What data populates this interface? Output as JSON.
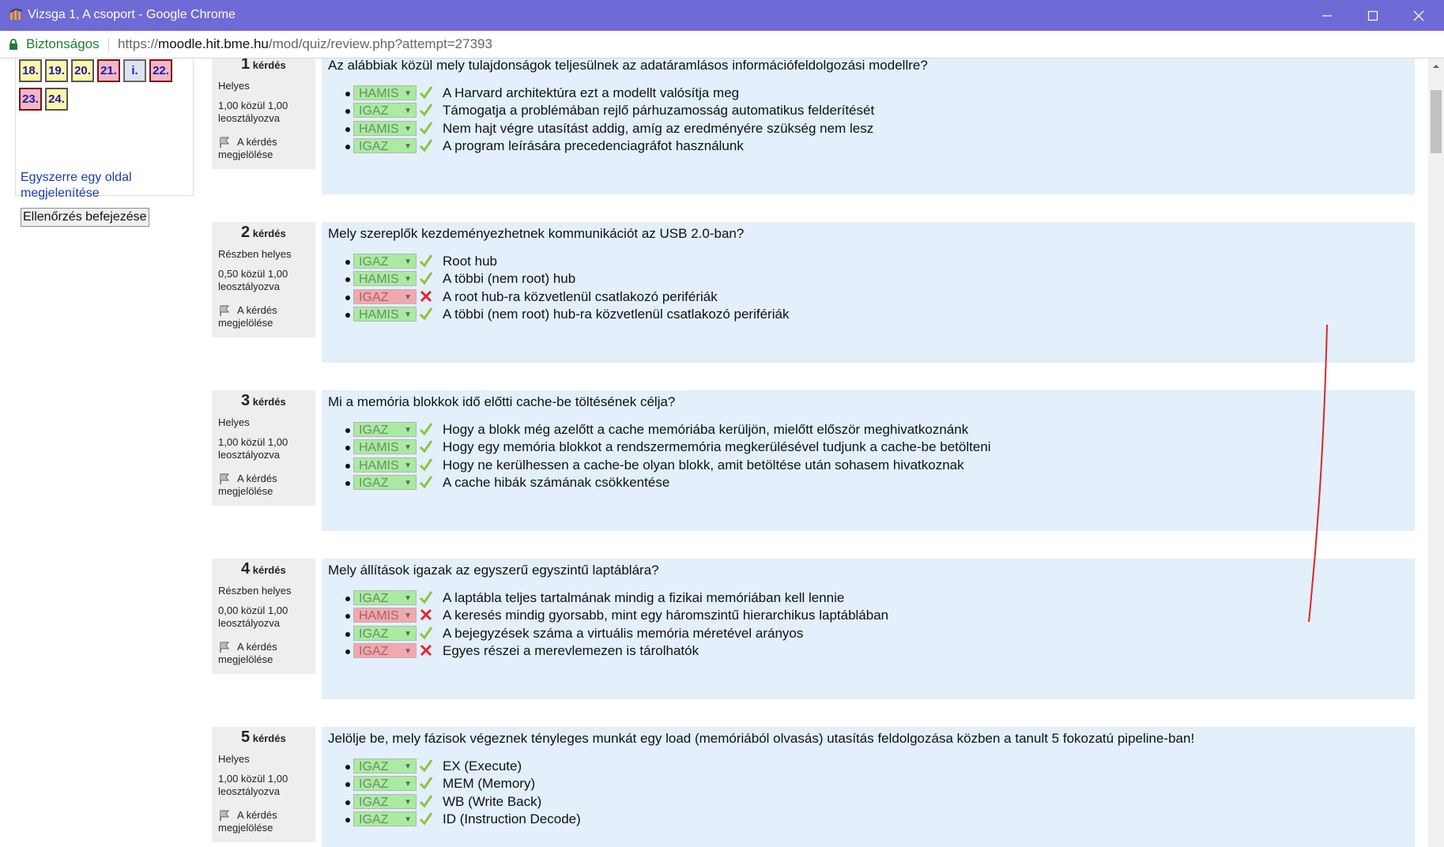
{
  "window": {
    "title": "Vizsga 1, A csoport - Google Chrome"
  },
  "addressbar": {
    "secure_label": "Biztonságos",
    "url_scheme": "https://",
    "url_host": "moodle.hit.bme.hu",
    "url_path": "/mod/quiz/review.php?attempt=27393"
  },
  "nav": {
    "buttons": [
      {
        "label": "18.",
        "state": "yellow"
      },
      {
        "label": "19.",
        "state": "yellow"
      },
      {
        "label": "20.",
        "state": "yellow"
      },
      {
        "label": "21.",
        "state": "red"
      },
      {
        "label": "i.",
        "state": "grey"
      },
      {
        "label": "22.",
        "state": "red"
      },
      {
        "label": "23.",
        "state": "red"
      },
      {
        "label": "24.",
        "state": "yellow"
      }
    ],
    "show_one_page": "Egyszerre egy oldal megjelenítése",
    "finish_review": "Ellenőrzés befejezése"
  },
  "questions": [
    {
      "num": "1",
      "num_suffix": "kérdés",
      "state": "Helyes",
      "grade_line1": "1,00 közül 1,00",
      "grade_line2": "leosztályozva",
      "flag_line1": "A kérdés",
      "flag_line2": "megjelölése",
      "text": "Az alábbiak közül mely tulajdonságok teljesülnek az adatáramlásos információfeldolgozási modellre?",
      "answers": [
        {
          "choice": "HAMIS",
          "correct": true,
          "text": "A Harvard architektúra ezt a modellt valósítja meg"
        },
        {
          "choice": "IGAZ",
          "correct": true,
          "text": "Támogatja a problémában rejlő párhuzamosság automatikus felderítését"
        },
        {
          "choice": "HAMIS",
          "correct": true,
          "text": "Nem hajt végre utasítást addig, amíg az eredményére szükség nem lesz"
        },
        {
          "choice": "IGAZ",
          "correct": true,
          "text": "A program leírására precedenciagráfot használunk"
        }
      ]
    },
    {
      "num": "2",
      "num_suffix": "kérdés",
      "state": "Részben helyes",
      "grade_line1": "0,50 közül 1,00",
      "grade_line2": "leosztályozva",
      "flag_line1": "A kérdés",
      "flag_line2": "megjelölése",
      "text": "Mely szereplők kezdeményezhetnek kommunikációt az USB 2.0-ban?",
      "answers": [
        {
          "choice": "IGAZ",
          "correct": true,
          "text": "Root hub"
        },
        {
          "choice": "HAMIS",
          "correct": true,
          "text": "A többi (nem root) hub"
        },
        {
          "choice": "IGAZ",
          "correct": false,
          "text": "A root hub-ra közvetlenül csatlakozó perifériák"
        },
        {
          "choice": "HAMIS",
          "correct": true,
          "text": "A többi (nem root) hub-ra közvetlenül csatlakozó perifériák"
        }
      ]
    },
    {
      "num": "3",
      "num_suffix": "kérdés",
      "state": "Helyes",
      "grade_line1": "1,00 közül 1,00",
      "grade_line2": "leosztályozva",
      "flag_line1": "A kérdés",
      "flag_line2": "megjelölése",
      "text": "Mi a memória blokkok idő előtti cache-be töltésének célja?",
      "answers": [
        {
          "choice": "IGAZ",
          "correct": true,
          "text": "Hogy a blokk még azelőtt a cache memóriába kerüljön, mielőtt először meghivatkoznánk"
        },
        {
          "choice": "HAMIS",
          "correct": true,
          "text": "Hogy egy memória blokkot a rendszermemória megkerülésével tudjunk a cache-be betölteni"
        },
        {
          "choice": "HAMIS",
          "correct": true,
          "text": "Hogy ne kerülhessen a cache-be olyan blokk, amit betöltése után sohasem hivatkoznak"
        },
        {
          "choice": "IGAZ",
          "correct": true,
          "text": "A cache hibák számának csökkentése"
        }
      ]
    },
    {
      "num": "4",
      "num_suffix": "kérdés",
      "state": "Részben helyes",
      "grade_line1": "0,00 közül 1,00",
      "grade_line2": "leosztályozva",
      "flag_line1": "A kérdés",
      "flag_line2": "megjelölése",
      "text": "Mely állítások igazak az egyszerű egyszintű laptáblára?",
      "answers": [
        {
          "choice": "IGAZ",
          "correct": true,
          "text": "A laptábla teljes tartalmának mindig a fizikai memóriában kell lennie"
        },
        {
          "choice": "HAMIS",
          "correct": false,
          "text": "A keresés mindig gyorsabb, mint egy háromszintű hierarchikus laptáblában"
        },
        {
          "choice": "IGAZ",
          "correct": true,
          "text": "A bejegyzések száma a virtuális memória méretével arányos"
        },
        {
          "choice": "IGAZ",
          "correct": false,
          "text": "Egyes részei a merevlemezen is tárolhatók"
        }
      ]
    },
    {
      "num": "5",
      "num_suffix": "kérdés",
      "state": "Helyes",
      "grade_line1": "1,00 közül 1,00",
      "grade_line2": "leosztályozva",
      "flag_line1": "A kérdés",
      "flag_line2": "megjelölése",
      "text": "Jelölje be, mely fázisok végeznek tényleges munkát egy load (memóriából olvasás) utasítás feldolgozása közben a tanult 5 fokozatú pipeline-ban!",
      "answers": [
        {
          "choice": "IGAZ",
          "correct": true,
          "text": "EX (Execute)"
        },
        {
          "choice": "IGAZ",
          "correct": true,
          "text": "MEM (Memory)"
        },
        {
          "choice": "IGAZ",
          "correct": true,
          "text": "WB (Write Back)"
        },
        {
          "choice": "IGAZ",
          "correct": true,
          "text": "ID (Instruction Decode)"
        }
      ]
    }
  ],
  "colors": {
    "titlebar": "#6e6ad6",
    "question_bg": "#e3effa",
    "correct_select": "#a9eba0",
    "wrong_select": "#f2a8ae",
    "check": "#8fc43c",
    "cross": "#e3262c"
  }
}
